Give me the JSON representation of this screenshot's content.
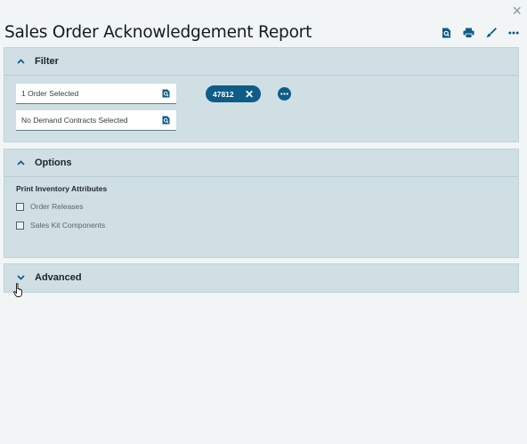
{
  "window": {
    "close_glyph": "×"
  },
  "page_title": "Sales Order Acknowledgement Report",
  "toolbar": {
    "icons": [
      "preview-icon",
      "print-icon",
      "clear-brush-icon",
      "more-icon"
    ]
  },
  "filter_panel": {
    "title": "Filter",
    "order_field": {
      "value": "1 Order Selected"
    },
    "contracts_field": {
      "value": "No Demand Contracts Selected"
    },
    "chip": {
      "label": "47812",
      "remove_glyph": "✕"
    }
  },
  "options_panel": {
    "title": "Options",
    "section_label": "Print Inventory Attributes",
    "checkboxes": [
      {
        "label": "Order Releases",
        "checked": false
      },
      {
        "label": "Sales Kit Components",
        "checked": false
      }
    ]
  },
  "advanced_panel": {
    "title": "Advanced"
  },
  "colors": {
    "accent": "#0e5c88",
    "panel_bg": "#d0dfe4",
    "page_bg": "#f1f5f5"
  }
}
